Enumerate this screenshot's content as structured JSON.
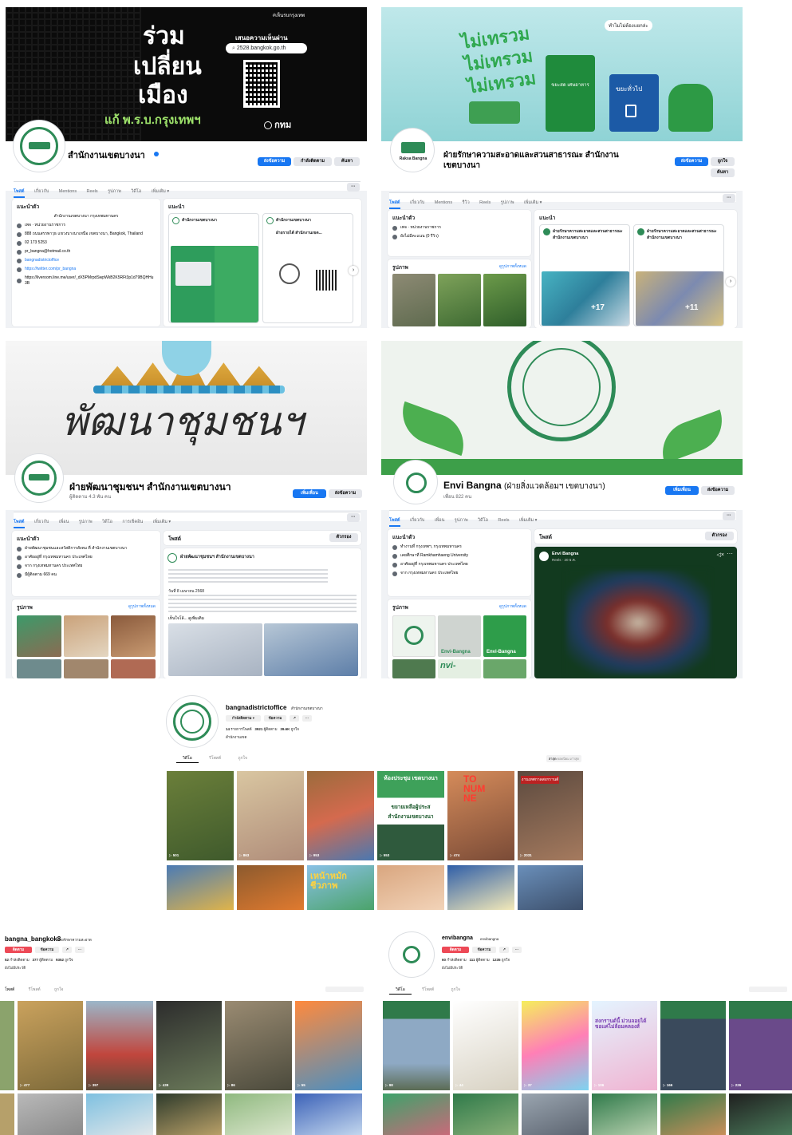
{
  "panel1": {
    "cover": {
      "hashtag": "#เห็นรบกรุงเทพ",
      "line1": "ร่วม",
      "line2": "เปลี่ยน",
      "line3": "เมือง",
      "subline": "แก้ พ.ร.บ.กรุงเทพฯ",
      "cta": "เสนอความเห็นผ่าน",
      "url": "2528.bangkok.go.th",
      "logo": "กทม"
    },
    "page_name": "สำนักงานเขตบางนา",
    "tabs": [
      "โพสต์",
      "เกี่ยวกับ",
      "Mentions",
      "Reels",
      "รูปภาพ",
      "วิดีโอ",
      "เพิ่มเติม ▾"
    ],
    "buttons": {
      "primary": "ส่งข้อความ",
      "follow": "กำลังติดตาม",
      "search": "ค้นหา"
    },
    "intro": {
      "title": "แนะนำตัว",
      "bio1": "สำนักงานเขตบางนา กรุงเทพมหานคร",
      "rows": [
        {
          "icon": "info-icon",
          "text": "เพจ · หน่วยงานราชการ"
        },
        {
          "icon": "location-icon",
          "text": "888 ถนนสรรพาวุธ แขวงบางนาเหนือ เขตบางนา, Bangkok, Thailand"
        },
        {
          "icon": "phone-icon",
          "text": "02 173 5253"
        },
        {
          "icon": "email-icon",
          "text": "pr_bangna@hotmail.co.th"
        },
        {
          "icon": "instagram-icon",
          "text": "bangnadistrictoffice",
          "link": true
        },
        {
          "icon": "x-twitter-icon",
          "text": "https://twitter.com/pr_bangna",
          "link": true
        },
        {
          "icon": "line-icon",
          "text": "https://liveroom.line.me/user/_dX5PMrpdSwpWkB2K5RFt3p1d79BQHHu3B"
        }
      ]
    },
    "featured_title": "แนะนำ",
    "featured": [
      {
        "author": "สำนักงานเขตบางนา"
      },
      {
        "author": "สำนักงานเขตบางนา",
        "sub_author": "ฝ่ายรายได้ สำนักงานเขต..."
      }
    ]
  },
  "panel2": {
    "cover": {
      "bubble": "ทำไมไม่ต้องแยกล่ะ",
      "slogan1": "ไม่เทรวม",
      "slogan2": "ไม่เทรวม",
      "slogan3": "ไม่เทรวม",
      "bin1": "ขยะสด เศษอาหาร",
      "bin2": "ขยะทั่วไป"
    },
    "badge": "Raksa Bangna",
    "page_name_1": "ฝ่ายรักษาความสะอาดและสวนสาธารณะ สำนักงาน",
    "page_name_2": "เขตบางนา",
    "buttons": {
      "primary": "ส่งข้อความ",
      "like": "ถูกใจ",
      "search": "ค้นหา"
    },
    "tabs": [
      "โพสต์",
      "เกี่ยวกับ",
      "Mentions",
      "รีวิว",
      "Reels",
      "รูปภาพ",
      "เพิ่มเติม ▾"
    ],
    "intro": {
      "title": "แนะนำตัว",
      "rows": [
        {
          "icon": "info-icon",
          "text": "เพจ · หน่วยงานราชการ"
        },
        {
          "icon": "star-icon",
          "text": "ยังไม่มีคะแนน (0 รีวิว)"
        }
      ]
    },
    "photos_title": "รูปภาพ",
    "photos_link": "ดูรูปภาพทั้งหมด",
    "featured_title": "แนะนำ",
    "featured": [
      {
        "author": "ฝ่ายรักษาความสะอาดและสวนสาธารณะ สำนักงานเขตบางนา",
        "more": "+17"
      },
      {
        "author": "ฝ่ายรักษาความสะอาดและสวนสาธารณะ สำนักงานเขตบางนา",
        "more": "+11"
      }
    ]
  },
  "panel3": {
    "cover": {
      "text": "พัฒนาชุมชนฯ"
    },
    "page_name": "ฝ่ายพัฒนาชุมชนฯ สำนักงานเขตบางนา",
    "followers": "ผู้ติดตาม 4.3 พัน คน",
    "buttons": {
      "primary": "เพิ่มเพื่อน",
      "message": "ส่งข้อความ"
    },
    "tabs": [
      "โพสต์",
      "เกี่ยวกับ",
      "เพื่อน",
      "รูปภาพ",
      "วิดีโอ",
      "การเช็คอิน",
      "เพิ่มเติม ▾"
    ],
    "intro": {
      "title": "แนะนำตัว",
      "rows": [
        {
          "icon": "work-icon",
          "text": "ฝ่ายพัฒนาชุมชนและสวัสดิการสังคม ที่ สำนักงานเขตบางนา"
        },
        {
          "icon": "home-icon",
          "text": "อาศัยอยู่ที่ กรุงเทพมหานคร ประเทศไทย"
        },
        {
          "icon": "location-icon",
          "text": "จาก กรุงเทพมหานคร ประเทศไทย"
        },
        {
          "icon": "rss-icon",
          "text": "มีผู้ติดตาม 669 คน"
        }
      ]
    },
    "photos_title": "รูปภาพ",
    "photos_link": "ดูรูปภาพทั้งหมด",
    "posts_title": "โพสต์",
    "filter": "ตัวกรอง",
    "post": {
      "author": "ฝ่ายพัฒนาชุมชนฯ สำนักงานเขตบางนา",
      "date": "วันที่ 8 เมษายน 2568",
      "see_more": "เห็นใจโล้... ดูเพิ่มเติม"
    }
  },
  "panel4": {
    "page_name": "Envi Bangna",
    "page_name_suffix": "(ฝ่ายสิ่งแวดล้อมฯ เขตบางนา)",
    "followers": "เพื่อน 822 คน",
    "buttons": {
      "primary": "เพิ่มเพื่อน",
      "message": "ส่งข้อความ"
    },
    "tabs": [
      "โพสต์",
      "เกี่ยวกับ",
      "เพื่อน",
      "รูปภาพ",
      "วิดีโอ",
      "Reels",
      "เพิ่มเติม ▾"
    ],
    "intro": {
      "title": "แนะนำตัว",
      "rows": [
        {
          "icon": "work-icon",
          "text": "ทำงานที่ กรุงเทพฯ, กรุงเทพมหานคร"
        },
        {
          "icon": "school-icon",
          "text": "เคยศึกษาที่ Ramkhamhaeng University"
        },
        {
          "icon": "home-icon",
          "text": "อาศัยอยู่ที่ กรุงเทพมหานคร ประเทศไทย"
        },
        {
          "icon": "location-icon",
          "text": "จาก กรุงเทพมหานคร ประเทศไทย"
        }
      ]
    },
    "photos_title": "รูปภาพ",
    "photos_link": "ดูรูปภาพทั้งหมด",
    "posts_title": "โพสต์",
    "filter": "ตัวกรอง",
    "reel": {
      "author": "Envi Bangna",
      "meta": "Reels · 20 ธ.ค."
    },
    "photo_labels": [
      "Envi-Bangna",
      "Envi-Bangna",
      "nvi-"
    ]
  },
  "panel5": {
    "username": "bangnadistrictoffice",
    "display_name": "สำนักงานเขตบางนา",
    "buttons": {
      "following": "กำลังติดตาม ▾",
      "message": "ข้อความ"
    },
    "stats": {
      "posts": "14",
      "posts_label": "รายการโพสต์",
      "followers": "3921",
      "followers_label": "ผู้ติดตาม",
      "following": "39.6K",
      "following_label": "ถูกใจ"
    },
    "bio": "สำนักงานเขต",
    "tabs": [
      "วิดีโอ",
      "รีโพสต์",
      "ถูกใจ"
    ],
    "sort": [
      "ล่าสุด",
      "ยอดนิยม",
      "เก่าสุด"
    ],
    "views": [
      "501",
      "863",
      "953",
      "553",
      "474",
      "2031"
    ],
    "thumb_texts": [
      "ห้องประชุม เขตบางนา",
      "ขยายเหลือผู้ประส",
      "สำนักงานเขตบางนา",
      "TO NUM NE",
      "งานเทศกาลสงกรานต์",
      "เหน้าหมัก ชีวภาพ"
    ]
  },
  "panel6": {
    "username": "bangna_bangkok8",
    "display_name": "ฝ่ายรักษาความสะอาด",
    "buttons": {
      "follow": "ติดตาม",
      "message": "ข้อความ"
    },
    "stats": {
      "posts": "52",
      "posts_label": "กำลังติดตาม",
      "followers": "377",
      "followers_label": "ผู้ติดตาม",
      "likes": "9352",
      "likes_label": "ถูกใจ"
    },
    "bio": "ยังไม่มีประวัติ",
    "tabs": [
      "โพสต์",
      "รีโพสต์",
      "ถูกใจ"
    ],
    "views": [
      "477",
      "397",
      "439",
      "86",
      "55"
    ]
  },
  "panel7": {
    "username": "envibangna",
    "display_name": "envibangna",
    "buttons": {
      "follow": "ติดตาม",
      "message": "ข้อความ"
    },
    "stats": {
      "posts": "60",
      "posts_label": "กำลังติดตาม",
      "followers": "111",
      "followers_label": "ผู้ติดตาม",
      "likes": "1235",
      "likes_label": "ถูกใจ"
    },
    "bio": "ยังไม่มีประวัติ",
    "tabs": [
      "วิดีโอ",
      "รีโพสต์",
      "ถูกใจ"
    ],
    "views": [
      "98",
      "44",
      "37",
      "106",
      "166",
      "226"
    ],
    "thumb_texts": [
      "สงกรานต์นี้ ม่วนจอยได้ ขอแค่ไม่ล้อมคลองส์"
    ]
  },
  "colors": {
    "facebook_blue": "#1877f2",
    "tiktok_red": "#ed4956",
    "green": "#2e8b57"
  }
}
